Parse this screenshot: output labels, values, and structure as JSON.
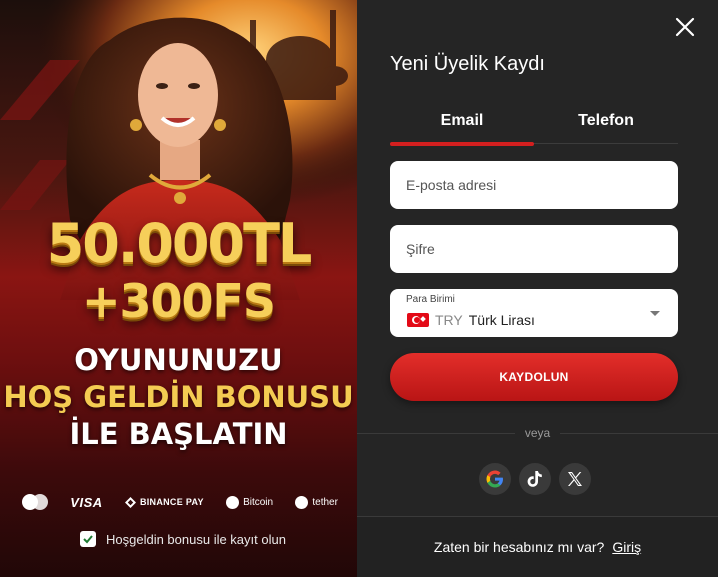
{
  "promo": {
    "amount": "50.000TL",
    "free_spins": "+300FS",
    "line1": "OYUNUNUZU",
    "line2": "HOŞ GELDİN BONUSU",
    "line3": "İLE BAŞLATIN",
    "payments": {
      "visa": "VISA",
      "binance": "BINANCE PAY",
      "bitcoin": "Bitcoin",
      "tether": "tether"
    },
    "bonus_checkbox_label": "Hoşgeldin bonusu ile kayıt olun",
    "bonus_checked": true
  },
  "form": {
    "title": "Yeni Üyelik Kaydı",
    "tabs": [
      {
        "label": "Email",
        "active": true
      },
      {
        "label": "Telefon",
        "active": false
      }
    ],
    "email_placeholder": "E-posta adresi",
    "password_placeholder": "Şifre",
    "currency": {
      "label": "Para Birimi",
      "code": "TRY",
      "name": "Türk Lirası"
    },
    "submit_label": "KAYDOLUN",
    "or_label": "veya",
    "socials": [
      "google-icon",
      "tiktok-icon",
      "x-icon"
    ],
    "footer_question": "Zaten bir hesabınız mı var?",
    "login_label": "Giriş"
  },
  "colors": {
    "accent_red": "#d41f1f",
    "panel_bg": "#252525",
    "gold": "#f6cf5a"
  }
}
